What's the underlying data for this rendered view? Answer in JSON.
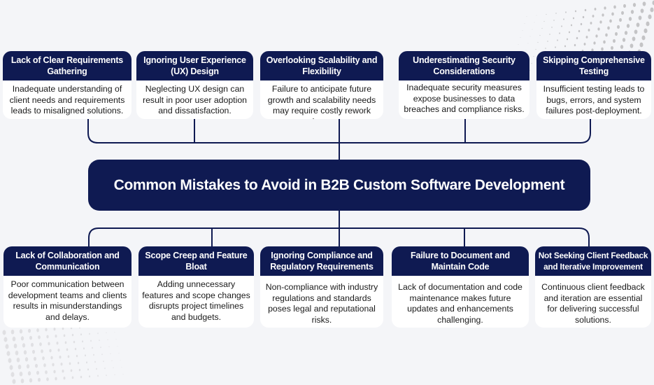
{
  "title": "Common Mistakes to Avoid in B2B Custom Software Development",
  "colors": {
    "header_bg": "#0f1a52",
    "card_bg": "#ffffff",
    "page_bg": "#f4f5f8",
    "connector": "#0f1a52"
  },
  "top_mistakes": [
    {
      "heading": "Lack of Clear Requirements Gathering",
      "description": "Inadequate understanding of client needs and requirements leads to misaligned solutions."
    },
    {
      "heading": "Ignoring User Experience (UX) Design",
      "description": "Neglecting UX design can result in  poor user adoption and dissatisfaction."
    },
    {
      "heading": "Overlooking Scalability and Flexibility",
      "description": "Failure to anticipate future growth and scalability needs may require costly rework later."
    },
    {
      "heading": "Underestimating Security Considerations",
      "description": "Inadequate security measures expose businesses to data breaches and compliance risks."
    },
    {
      "heading": "Skipping Comprehensive Testing",
      "description": "Insufficient testing leads to bugs, errors, and system failures post-deployment."
    }
  ],
  "bottom_mistakes": [
    {
      "heading": "Lack of Collaboration and Communication",
      "description": "Poor communication between development teams and clients results in misunderstandings and delays."
    },
    {
      "heading": "Scope Creep and Feature Bloat",
      "description": "Adding unnecessary features and scope changes disrupts project timelines and budgets."
    },
    {
      "heading": "Ignoring Compliance and Regulatory Requirements",
      "description": "Non-compliance with industry regulations and standards poses legal and reputational risks."
    },
    {
      "heading": "Failure to Document and Maintain Code",
      "description": "Lack of documentation and code maintenance makes future updates and enhancements challenging."
    },
    {
      "heading": "Not Seeking Client Feedback and Iterative Improvement",
      "description": "Continuous client feedback and iteration are essential for delivering successful solutions."
    }
  ]
}
